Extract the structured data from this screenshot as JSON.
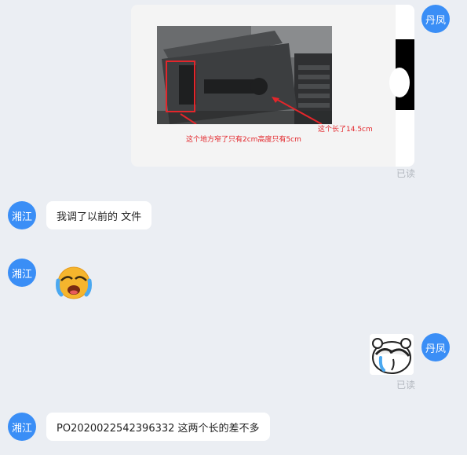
{
  "messages": [
    {
      "sender": "丹凤",
      "type": "image",
      "image": {
        "caption_left": "这个地方窄了只有2cm高度只有5cm",
        "caption_right": "这个长了14.5cm"
      },
      "status": "已读"
    },
    {
      "sender": "湘江",
      "type": "text",
      "text": "我调了以前的 文件"
    },
    {
      "sender": "湘江",
      "type": "emoji",
      "emoji": "😭"
    },
    {
      "sender": "丹凤",
      "type": "sticker",
      "status": "已读"
    },
    {
      "sender": "湘江",
      "type": "text",
      "text": "PO2020022542396332  这两个长的差不多"
    }
  ],
  "colors": {
    "avatar": "#3a8ef6",
    "background": "#ebeef3",
    "bubble": "#ffffff",
    "annotation": "#e3262b"
  }
}
